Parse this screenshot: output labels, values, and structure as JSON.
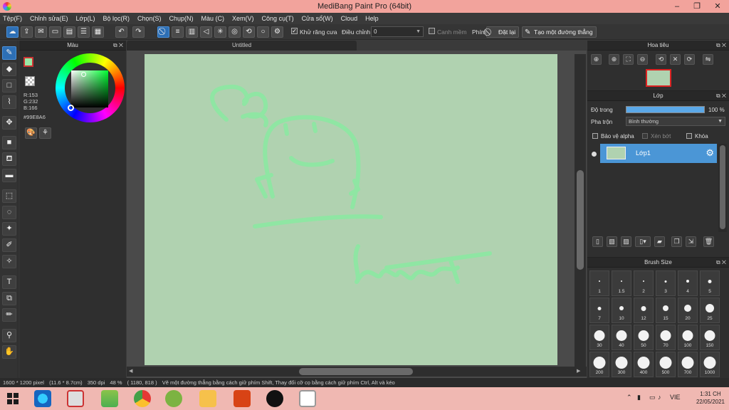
{
  "window": {
    "title": "MediBang Paint Pro (64bit)",
    "controls": {
      "minimize": "–",
      "maximize": "❐",
      "close": "✕"
    }
  },
  "menu": [
    "Tệp(F)",
    "Chỉnh sửa(E)",
    "Lớp(L)",
    "Bộ lọc(R)",
    "Chọn(S)",
    "Chụp(N)",
    "Màu (C)",
    "Xem(V)",
    "Công cụ(T)",
    "Cửa sổ(W)",
    "Cloud",
    "Help"
  ],
  "toolbar": {
    "antialias_label": "Khử răng cưa",
    "adjust_label": "Điều chỉnh",
    "adjust_value": "0",
    "snap_edge_label": "Canh mềm",
    "key_label": "Phím",
    "reset_label": "Đặt lại",
    "straight_line_label": "Tạo một đường thẳng"
  },
  "color_panel": {
    "title": "Màu",
    "r": "R:153",
    "g": "G:232",
    "b": "B:166",
    "hex": "#99E8A6",
    "foreground": "#99e8a6"
  },
  "canvas": {
    "tab_title": "Untitled",
    "background": "#b0d2b0",
    "stroke_color": "#8fe6a3"
  },
  "navigator": {
    "title": "Hoa tiêu"
  },
  "layer_panel": {
    "title": "Lớp",
    "opacity_label": "Độ trong",
    "opacity_value": "100 %",
    "opacity": 1.0,
    "blend_label": "Pha trộn",
    "blend_value": "Bình thường",
    "protect_alpha_label": "Bảo vệ alpha",
    "clip_label": "Xén bớt",
    "lock_label": "Khóa",
    "layer_name": "Lớp1"
  },
  "brush_panel": {
    "title": "Brush Size",
    "sizes": [
      "1",
      "1.5",
      "2",
      "3",
      "4",
      "5",
      "7",
      "10",
      "12",
      "15",
      "20",
      "25",
      "30",
      "40",
      "50",
      "70",
      "100",
      "150",
      "200",
      "300",
      "400",
      "500",
      "700",
      "1000"
    ]
  },
  "status": {
    "dimensions": "1600 * 1200 pixel",
    "physical": "(11.6 * 8.7cm)",
    "dpi": "350 dpi",
    "zoom": "48 %",
    "coords": "( 1180, 818 )",
    "hint": "Vẽ một đường thẳng bằng cách giữ phím Shift, Thay đổi cỡ cọ bằng cách giữ phím Ctrl, Alt và kéo"
  },
  "taskbar": {
    "language": "VIE",
    "time": "1:31 CH",
    "date": "22/05/2021"
  }
}
